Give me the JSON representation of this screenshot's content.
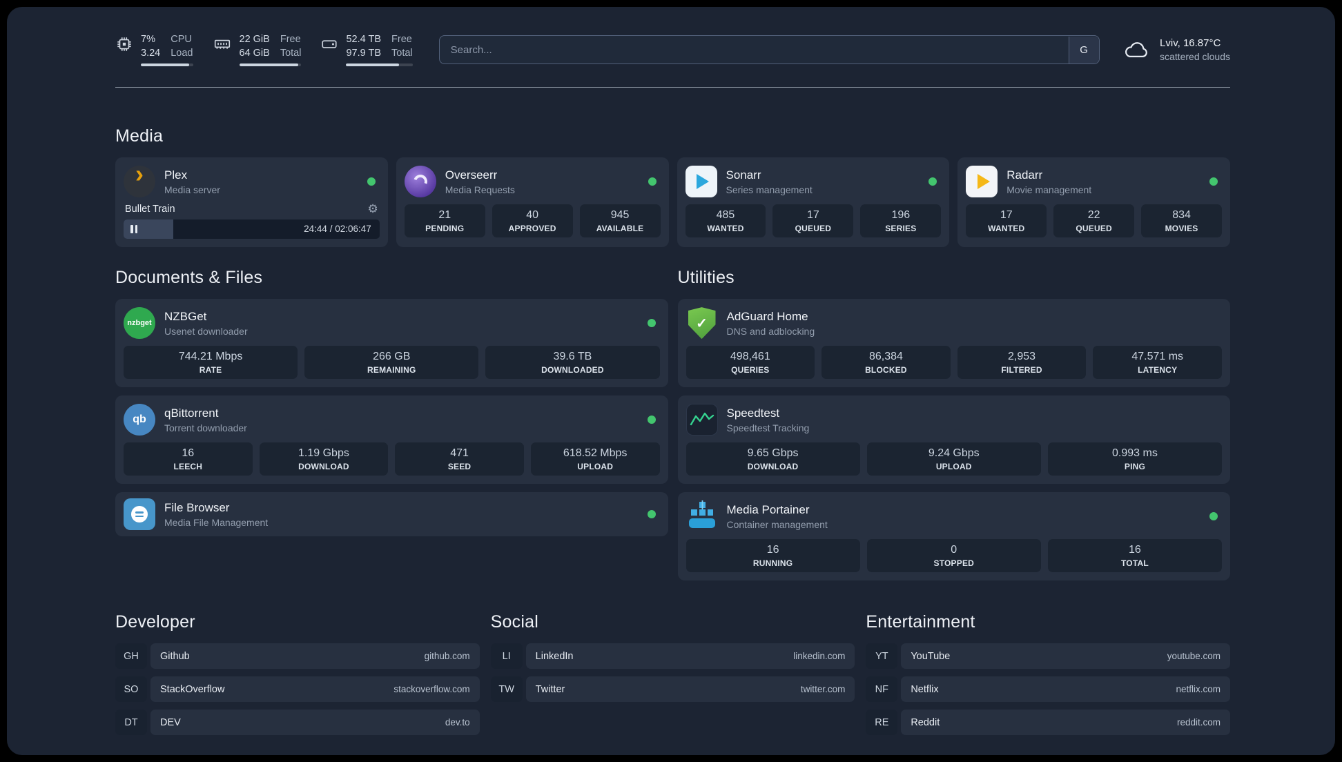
{
  "colors": {
    "background": "#1c2433",
    "card": "#273040",
    "stat_tile": "#1b2431",
    "status_online": "#43c56e",
    "plex_accent": "#e5a00d"
  },
  "topbar": {
    "cpu": {
      "value_top": "7%",
      "value_bottom": "3.24",
      "label_top": "CPU",
      "label_bottom": "Load",
      "bar_pct": 93
    },
    "memory": {
      "value_top": "22 GiB",
      "value_bottom": "64 GiB",
      "label_top": "Free",
      "label_bottom": "Total",
      "bar_pct": 95
    },
    "disk": {
      "value_top": "52.4 TB",
      "value_bottom": "97.9 TB",
      "label_top": "Free",
      "label_bottom": "Total",
      "bar_pct": 80
    },
    "search": {
      "placeholder": "Search...",
      "button_label": "G"
    },
    "weather": {
      "location": "Lviv, 16.87°C",
      "condition": "scattered clouds"
    }
  },
  "sections": {
    "media": {
      "heading": "Media",
      "plex": {
        "name": "Plex",
        "desc": "Media server",
        "now_playing": "Bullet Train",
        "time": "24:44 / 02:06:47",
        "progress_pct": 19.5
      },
      "overseerr": {
        "name": "Overseerr",
        "desc": "Media Requests",
        "stats": [
          {
            "value": "21",
            "label": "PENDING"
          },
          {
            "value": "40",
            "label": "APPROVED"
          },
          {
            "value": "945",
            "label": "AVAILABLE"
          }
        ]
      },
      "sonarr": {
        "name": "Sonarr",
        "desc": "Series management",
        "stats": [
          {
            "value": "485",
            "label": "WANTED"
          },
          {
            "value": "17",
            "label": "QUEUED"
          },
          {
            "value": "196",
            "label": "SERIES"
          }
        ]
      },
      "radarr": {
        "name": "Radarr",
        "desc": "Movie management",
        "stats": [
          {
            "value": "17",
            "label": "WANTED"
          },
          {
            "value": "22",
            "label": "QUEUED"
          },
          {
            "value": "834",
            "label": "MOVIES"
          }
        ]
      }
    },
    "documents": {
      "heading": "Documents & Files",
      "nzbget": {
        "name": "NZBGet",
        "desc": "Usenet downloader",
        "icon_text": "nzbget",
        "stats": [
          {
            "value": "744.21 Mbps",
            "label": "RATE"
          },
          {
            "value": "266 GB",
            "label": "REMAINING"
          },
          {
            "value": "39.6 TB",
            "label": "DOWNLOADED"
          }
        ]
      },
      "qbittorrent": {
        "name": "qBittorrent",
        "desc": "Torrent downloader",
        "icon_text": "qb",
        "stats": [
          {
            "value": "16",
            "label": "LEECH"
          },
          {
            "value": "1.19 Gbps",
            "label": "DOWNLOAD"
          },
          {
            "value": "471",
            "label": "SEED"
          },
          {
            "value": "618.52 Mbps",
            "label": "UPLOAD"
          }
        ]
      },
      "filebrowser": {
        "name": "File Browser",
        "desc": "Media File Management"
      }
    },
    "utilities": {
      "heading": "Utilities",
      "adguard": {
        "name": "AdGuard Home",
        "desc": "DNS and adblocking",
        "stats": [
          {
            "value": "498,461",
            "label": "QUERIES"
          },
          {
            "value": "86,384",
            "label": "BLOCKED"
          },
          {
            "value": "2,953",
            "label": "FILTERED"
          },
          {
            "value": "47.571 ms",
            "label": "LATENCY"
          }
        ]
      },
      "speedtest": {
        "name": "Speedtest",
        "desc": "Speedtest Tracking",
        "stats": [
          {
            "value": "9.65 Gbps",
            "label": "DOWNLOAD"
          },
          {
            "value": "9.24 Gbps",
            "label": "UPLOAD"
          },
          {
            "value": "0.993 ms",
            "label": "PING"
          }
        ]
      },
      "portainer": {
        "name": "Media Portainer",
        "desc": "Container management",
        "stats": [
          {
            "value": "16",
            "label": "RUNNING"
          },
          {
            "value": "0",
            "label": "STOPPED"
          },
          {
            "value": "16",
            "label": "TOTAL"
          }
        ]
      }
    }
  },
  "bookmarks": {
    "developer": {
      "heading": "Developer",
      "items": [
        {
          "abbr": "GH",
          "name": "Github",
          "url": "github.com"
        },
        {
          "abbr": "SO",
          "name": "StackOverflow",
          "url": "stackoverflow.com"
        },
        {
          "abbr": "DT",
          "name": "DEV",
          "url": "dev.to"
        }
      ]
    },
    "social": {
      "heading": "Social",
      "items": [
        {
          "abbr": "LI",
          "name": "LinkedIn",
          "url": "linkedin.com"
        },
        {
          "abbr": "TW",
          "name": "Twitter",
          "url": "twitter.com"
        }
      ]
    },
    "entertainment": {
      "heading": "Entertainment",
      "items": [
        {
          "abbr": "YT",
          "name": "YouTube",
          "url": "youtube.com"
        },
        {
          "abbr": "NF",
          "name": "Netflix",
          "url": "netflix.com"
        },
        {
          "abbr": "RE",
          "name": "Reddit",
          "url": "reddit.com"
        }
      ]
    }
  }
}
